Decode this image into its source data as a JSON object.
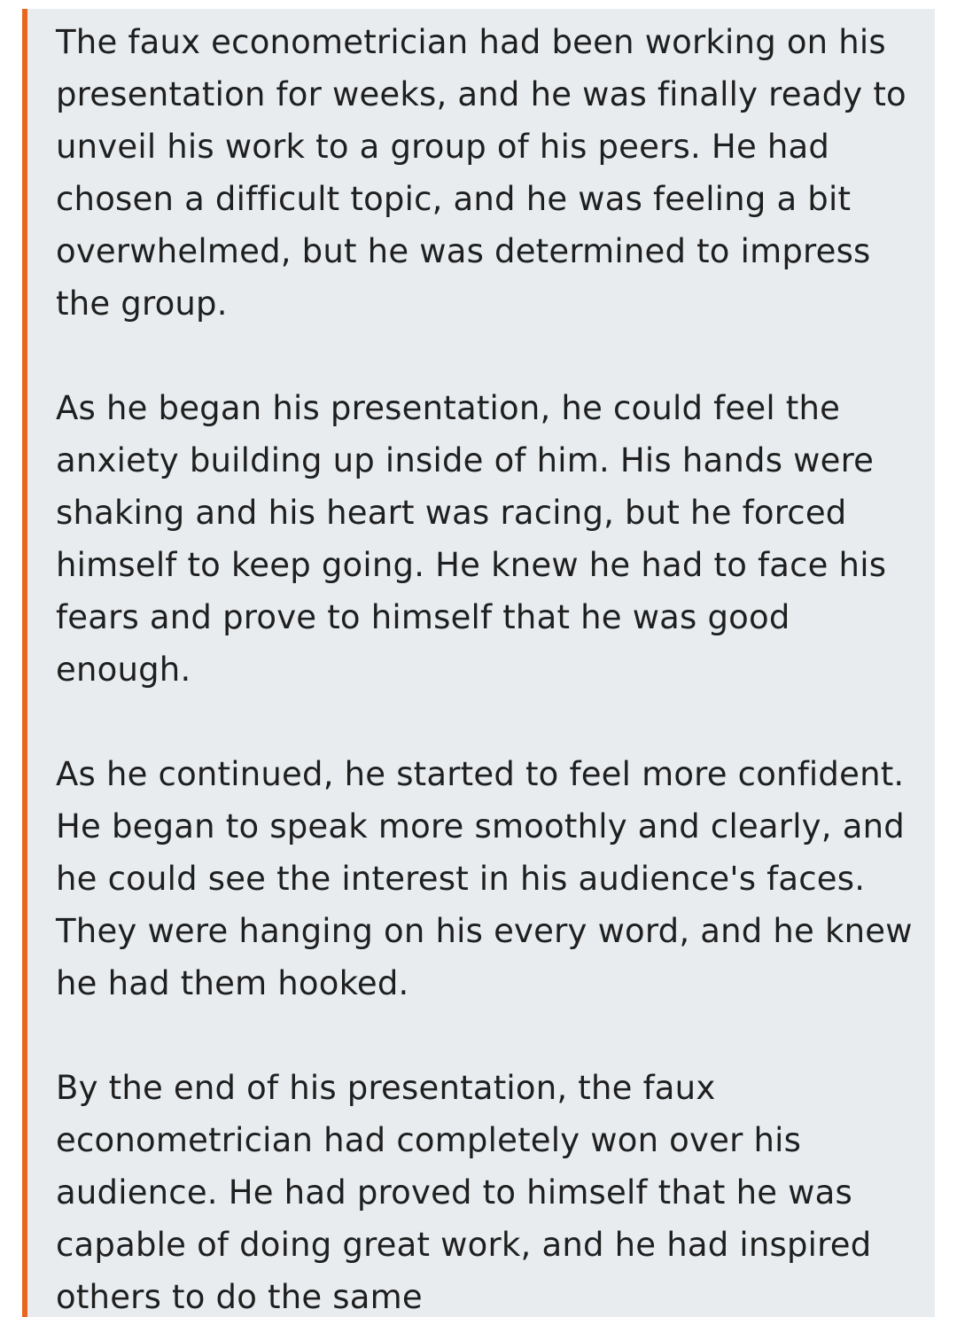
{
  "colors": {
    "accent_border": "#e8661e",
    "block_background": "#e8ecef",
    "text": "#1f1f1f"
  },
  "story": {
    "paragraphs": [
      "The faux econometrician had been working on his presentation for weeks, and he was finally ready to unveil his work to a group of his peers. He had chosen a difficult topic, and he was feeling a bit overwhelmed, but he was determined to impress the group.",
      "As he began his presentation, he could feel the anxiety building up inside of him. His hands were shaking and his heart was racing, but he forced himself to keep going. He knew he had to face his fears and prove to himself that he was good enough.",
      "As he continued, he started to feel more confident. He began to speak more smoothly and clearly, and he could see the interest in his audience's faces. They were hanging on his every word, and he knew he had them hooked.",
      "By the end of his presentation, the faux econometrician had completely won over his audience. He had proved to himself that he was capable of doing great work, and he had inspired others to do the same"
    ]
  }
}
